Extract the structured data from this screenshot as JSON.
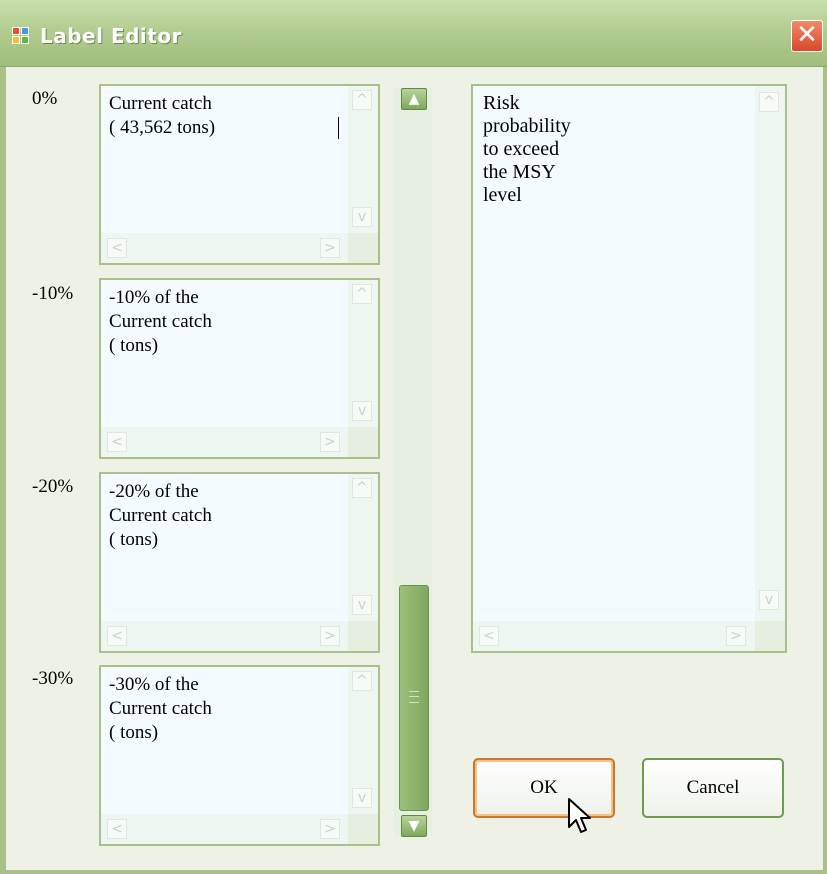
{
  "window": {
    "title": "Label Editor",
    "close_glyph": "✕"
  },
  "rows": [
    {
      "percent": "0%",
      "text": "Current catch\n( 43,562 tons)"
    },
    {
      "percent": "-10%",
      "text": "-10% of the\nCurrent catch\n(  tons)"
    },
    {
      "percent": "-20%",
      "text": "-20% of the\nCurrent catch\n(  tons)"
    },
    {
      "percent": "-30%",
      "text": "-30% of the\nCurrent catch\n(  tons)"
    }
  ],
  "side_label": {
    "text": "Risk\nprobability\nto exceed\nthe MSY\nlevel"
  },
  "buttons": {
    "ok": "OK",
    "cancel": "Cancel"
  },
  "scrollbar": {
    "up_glyph": "▲",
    "down_glyph": "▼"
  },
  "icons": {
    "app": "app-window-icon",
    "close": "close-icon",
    "cursor": "mouse-pointer-icon"
  }
}
